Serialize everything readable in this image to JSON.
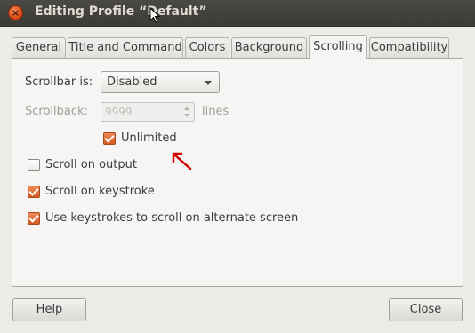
{
  "window": {
    "title": "Editing Profile “Default”",
    "close_glyph": "×"
  },
  "tabs": [
    {
      "label": "General",
      "active": false
    },
    {
      "label": "Title and Command",
      "active": false
    },
    {
      "label": "Colors",
      "active": false
    },
    {
      "label": "Background",
      "active": false
    },
    {
      "label": "Scrolling",
      "active": true
    },
    {
      "label": "Compatibility",
      "active": false
    }
  ],
  "scrolling": {
    "scrollbar_label": "Scrollbar is:",
    "scrollbar_value": "Disabled",
    "scrollback_label": "Scrollback:",
    "scrollback_value": "9999",
    "scrollback_unit": "lines",
    "unlimited_label": "Unlimited",
    "unlimited_checked": true,
    "scroll_on_output_label": "Scroll on output",
    "scroll_on_output_checked": false,
    "scroll_on_keystroke_label": "Scroll on keystroke",
    "scroll_on_keystroke_checked": true,
    "alternate_screen_label": "Use keystrokes to scroll on alternate screen",
    "alternate_screen_checked": true
  },
  "buttons": {
    "help": "Help",
    "close": "Close"
  },
  "colors": {
    "accent": "#dd4814",
    "annotation_arrow": "#d20000",
    "titlebar": "#3c3b37"
  }
}
